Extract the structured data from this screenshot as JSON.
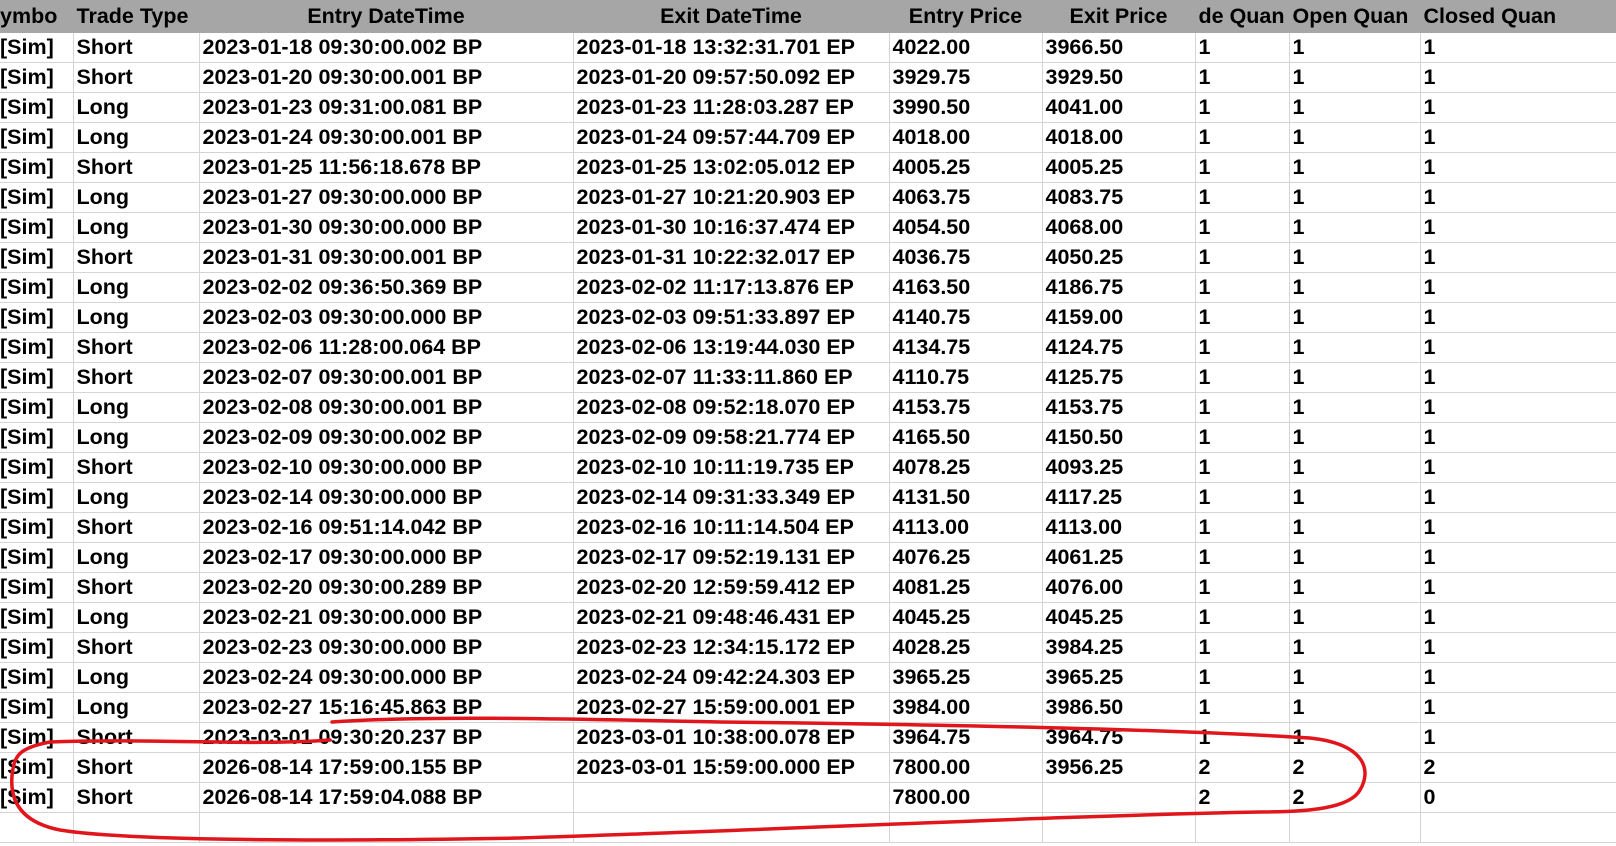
{
  "headers": {
    "symbol": "ymbo",
    "trade_type": "Trade Type",
    "entry_datetime": "Entry DateTime",
    "exit_datetime": "Exit DateTime",
    "entry_price": "Entry Price",
    "exit_price": "Exit Price",
    "trade_quantity": "de Quan",
    "open_quantity": "Open Quan",
    "closed_quantity": "Closed Quan"
  },
  "rows": [
    {
      "symbol": "[Sim]",
      "type": "Short",
      "entry": "2023-01-18  09:30:00.002 BP",
      "exit": "2023-01-18  13:32:31.701 EP",
      "entry_price": "4022.00",
      "exit_price": "3966.50",
      "trade_qty": "1",
      "open_qty": "1",
      "closed_qty": "1"
    },
    {
      "symbol": "[Sim]",
      "type": "Short",
      "entry": "2023-01-20  09:30:00.001 BP",
      "exit": "2023-01-20  09:57:50.092 EP",
      "entry_price": "3929.75",
      "exit_price": "3929.50",
      "trade_qty": "1",
      "open_qty": "1",
      "closed_qty": "1"
    },
    {
      "symbol": "[Sim]",
      "type": "Long",
      "entry": "2023-01-23  09:31:00.081 BP",
      "exit": "2023-01-23  11:28:03.287 EP",
      "entry_price": "3990.50",
      "exit_price": "4041.00",
      "trade_qty": "1",
      "open_qty": "1",
      "closed_qty": "1"
    },
    {
      "symbol": "[Sim]",
      "type": "Long",
      "entry": "2023-01-24  09:30:00.001 BP",
      "exit": "2023-01-24  09:57:44.709 EP",
      "entry_price": "4018.00",
      "exit_price": "4018.00",
      "trade_qty": "1",
      "open_qty": "1",
      "closed_qty": "1"
    },
    {
      "symbol": "[Sim]",
      "type": "Short",
      "entry": "2023-01-25  11:56:18.678 BP",
      "exit": "2023-01-25  13:02:05.012 EP",
      "entry_price": "4005.25",
      "exit_price": "4005.25",
      "trade_qty": "1",
      "open_qty": "1",
      "closed_qty": "1"
    },
    {
      "symbol": "[Sim]",
      "type": "Long",
      "entry": "2023-01-27  09:30:00.000 BP",
      "exit": "2023-01-27  10:21:20.903 EP",
      "entry_price": "4063.75",
      "exit_price": "4083.75",
      "trade_qty": "1",
      "open_qty": "1",
      "closed_qty": "1"
    },
    {
      "symbol": "[Sim]",
      "type": "Long",
      "entry": "2023-01-30  09:30:00.000 BP",
      "exit": "2023-01-30  10:16:37.474 EP",
      "entry_price": "4054.50",
      "exit_price": "4068.00",
      "trade_qty": "1",
      "open_qty": "1",
      "closed_qty": "1"
    },
    {
      "symbol": "[Sim]",
      "type": "Short",
      "entry": "2023-01-31  09:30:00.001 BP",
      "exit": "2023-01-31  10:22:32.017 EP",
      "entry_price": "4036.75",
      "exit_price": "4050.25",
      "trade_qty": "1",
      "open_qty": "1",
      "closed_qty": "1"
    },
    {
      "symbol": "[Sim]",
      "type": "Long",
      "entry": "2023-02-02  09:36:50.369 BP",
      "exit": "2023-02-02  11:17:13.876 EP",
      "entry_price": "4163.50",
      "exit_price": "4186.75",
      "trade_qty": "1",
      "open_qty": "1",
      "closed_qty": "1"
    },
    {
      "symbol": "[Sim]",
      "type": "Long",
      "entry": "2023-02-03  09:30:00.000 BP",
      "exit": "2023-02-03  09:51:33.897 EP",
      "entry_price": "4140.75",
      "exit_price": "4159.00",
      "trade_qty": "1",
      "open_qty": "1",
      "closed_qty": "1"
    },
    {
      "symbol": "[Sim]",
      "type": "Short",
      "entry": "2023-02-06  11:28:00.064 BP",
      "exit": "2023-02-06  13:19:44.030 EP",
      "entry_price": "4134.75",
      "exit_price": "4124.75",
      "trade_qty": "1",
      "open_qty": "1",
      "closed_qty": "1"
    },
    {
      "symbol": "[Sim]",
      "type": "Short",
      "entry": "2023-02-07  09:30:00.001 BP",
      "exit": "2023-02-07  11:33:11.860 EP",
      "entry_price": "4110.75",
      "exit_price": "4125.75",
      "trade_qty": "1",
      "open_qty": "1",
      "closed_qty": "1"
    },
    {
      "symbol": "[Sim]",
      "type": "Long",
      "entry": "2023-02-08  09:30:00.001 BP",
      "exit": "2023-02-08  09:52:18.070 EP",
      "entry_price": "4153.75",
      "exit_price": "4153.75",
      "trade_qty": "1",
      "open_qty": "1",
      "closed_qty": "1"
    },
    {
      "symbol": "[Sim]",
      "type": "Long",
      "entry": "2023-02-09  09:30:00.002 BP",
      "exit": "2023-02-09  09:58:21.774 EP",
      "entry_price": "4165.50",
      "exit_price": "4150.50",
      "trade_qty": "1",
      "open_qty": "1",
      "closed_qty": "1"
    },
    {
      "symbol": "[Sim]",
      "type": "Short",
      "entry": "2023-02-10  09:30:00.000 BP",
      "exit": "2023-02-10  10:11:19.735 EP",
      "entry_price": "4078.25",
      "exit_price": "4093.25",
      "trade_qty": "1",
      "open_qty": "1",
      "closed_qty": "1"
    },
    {
      "symbol": "[Sim]",
      "type": "Long",
      "entry": "2023-02-14  09:30:00.000 BP",
      "exit": "2023-02-14  09:31:33.349 EP",
      "entry_price": "4131.50",
      "exit_price": "4117.25",
      "trade_qty": "1",
      "open_qty": "1",
      "closed_qty": "1"
    },
    {
      "symbol": "[Sim]",
      "type": "Short",
      "entry": "2023-02-16  09:51:14.042 BP",
      "exit": "2023-02-16  10:11:14.504 EP",
      "entry_price": "4113.00",
      "exit_price": "4113.00",
      "trade_qty": "1",
      "open_qty": "1",
      "closed_qty": "1"
    },
    {
      "symbol": "[Sim]",
      "type": "Long",
      "entry": "2023-02-17  09:30:00.000 BP",
      "exit": "2023-02-17  09:52:19.131 EP",
      "entry_price": "4076.25",
      "exit_price": "4061.25",
      "trade_qty": "1",
      "open_qty": "1",
      "closed_qty": "1"
    },
    {
      "symbol": "[Sim]",
      "type": "Short",
      "entry": "2023-02-20  09:30:00.289 BP",
      "exit": "2023-02-20  12:59:59.412 EP",
      "entry_price": "4081.25",
      "exit_price": "4076.00",
      "trade_qty": "1",
      "open_qty": "1",
      "closed_qty": "1"
    },
    {
      "symbol": "[Sim]",
      "type": "Long",
      "entry": "2023-02-21  09:30:00.000 BP",
      "exit": "2023-02-21  09:48:46.431 EP",
      "entry_price": "4045.25",
      "exit_price": "4045.25",
      "trade_qty": "1",
      "open_qty": "1",
      "closed_qty": "1"
    },
    {
      "symbol": "[Sim]",
      "type": "Short",
      "entry": "2023-02-23  09:30:00.000 BP",
      "exit": "2023-02-23  12:34:15.172 EP",
      "entry_price": "4028.25",
      "exit_price": "3984.25",
      "trade_qty": "1",
      "open_qty": "1",
      "closed_qty": "1"
    },
    {
      "symbol": "[Sim]",
      "type": "Long",
      "entry": "2023-02-24  09:30:00.000 BP",
      "exit": "2023-02-24  09:42:24.303 EP",
      "entry_price": "3965.25",
      "exit_price": "3965.25",
      "trade_qty": "1",
      "open_qty": "1",
      "closed_qty": "1"
    },
    {
      "symbol": "[Sim]",
      "type": "Long",
      "entry": "2023-02-27  15:16:45.863 BP",
      "exit": "2023-02-27  15:59:00.001 EP",
      "entry_price": "3984.00",
      "exit_price": "3986.50",
      "trade_qty": "1",
      "open_qty": "1",
      "closed_qty": "1"
    },
    {
      "symbol": "[Sim]",
      "type": "Short",
      "entry": "2023-03-01  09:30:20.237 BP",
      "exit": "2023-03-01  10:38:00.078 EP",
      "entry_price": "3964.75",
      "exit_price": "3964.75",
      "trade_qty": "1",
      "open_qty": "1",
      "closed_qty": "1"
    },
    {
      "symbol": "[Sim]",
      "type": "Short",
      "entry": "2026-08-14  17:59:00.155 BP",
      "exit": "2023-03-01  15:59:00.000 EP",
      "entry_price": "7800.00",
      "exit_price": "3956.25",
      "trade_qty": "2",
      "open_qty": "2",
      "closed_qty": "2"
    },
    {
      "symbol": "[Sim]",
      "type": "Short",
      "entry": "2026-08-14  17:59:04.088 BP",
      "exit": "",
      "entry_price": "7800.00",
      "exit_price": "",
      "trade_qty": "2",
      "open_qty": "2",
      "closed_qty": "0"
    }
  ],
  "empty_rows": 1,
  "colors": {
    "header_bg": "#a6a6a6",
    "gridline": "#d4d4d4",
    "annotation": "#e0161c"
  }
}
